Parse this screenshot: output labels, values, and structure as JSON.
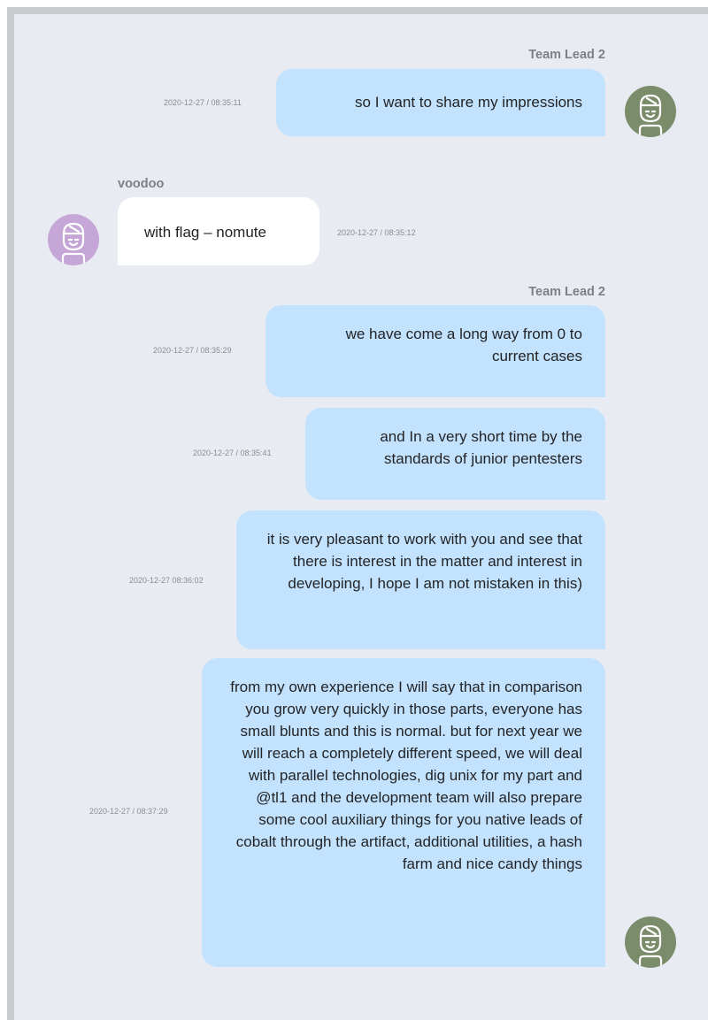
{
  "colors": {
    "page_background": "#e8ecf2",
    "outgoing_bubble": "#c2e2fd",
    "incoming_bubble": "#ffffff",
    "avatar_team_lead": "#7b8c6a",
    "avatar_voodoo": "#c5a6d6",
    "sender_text": "#7d8085",
    "timestamp_text": "#8a8d92"
  },
  "messages": [
    {
      "sender": "Team Lead 2",
      "direction": "outgoing",
      "timestamp": "2020-12-27 / 08:35:11",
      "text": "so I want to share my impressions",
      "avatar_icon": "user-icon"
    },
    {
      "sender": "voodoo",
      "direction": "incoming",
      "timestamp": "2020-12-27 / 08:35:12",
      "text": "with flag – nomute",
      "avatar_icon": "user-icon"
    },
    {
      "sender": "Team Lead 2",
      "direction": "outgoing",
      "timestamp": "2020-12-27 / 08:35:29",
      "text": "we have come a long way from 0 to current cases"
    },
    {
      "direction": "outgoing",
      "timestamp": "2020-12-27 / 08:35:41",
      "text": "and In a very short time by the standards of junior pentesters"
    },
    {
      "direction": "outgoing",
      "timestamp": "2020-12-27 08:36:02",
      "text": "it is very pleasant to work with you and see that there is interest in the matter and interest in developing, I hope I am not mistaken in this)"
    },
    {
      "direction": "outgoing",
      "timestamp": "2020-12-27 / 08:37:29",
      "text": "from my own experience I will say that in comparison you grow very quickly in those parts, everyone has small blunts and this is normal. but for next year we will reach a completely different speed, we will deal with parallel technologies, dig unix for my part and @tl1 and the development team will also prepare some cool auxiliary things for you native leads of cobalt through the artifact, additional utilities, a hash farm and nice candy things",
      "avatar_icon": "user-icon"
    }
  ]
}
